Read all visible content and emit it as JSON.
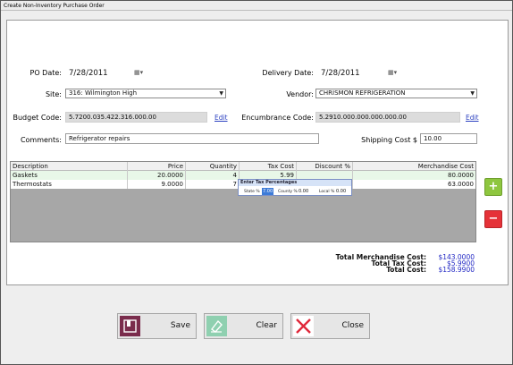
{
  "window": {
    "title": "Create Non-Inventory Purchase Order"
  },
  "form": {
    "po_date_label": "PO Date:",
    "po_date_value": "7/28/2011",
    "delivery_date_label": "Delivery Date:",
    "delivery_date_value": "7/28/2011",
    "site_label": "Site:",
    "site_value": "316: Wilmington High",
    "vendor_label": "Vendor:",
    "vendor_value": "CHRISMON REFRIGERATION",
    "budget_code_label": "Budget Code:",
    "budget_code_value": "5.7200.035.422.316.000.00",
    "budget_edit_label": "Edit",
    "encumbrance_code_label": "Encumbrance Code:",
    "encumbrance_code_value": "5.2910.000.000.000.000.00",
    "encumbrance_edit_label": "Edit",
    "comments_label": "Comments:",
    "comments_value": "Refrigerator repairs",
    "shipping_cost_label": "Shipping Cost $",
    "shipping_cost_value": "10.00"
  },
  "grid": {
    "columns": [
      "Description",
      "Price",
      "Quantity",
      "Tax Cost",
      "Discount %",
      "Merchandise Cost"
    ],
    "rows": [
      {
        "description": "Gaskets",
        "price": "20.0000",
        "quantity": "4",
        "tax_cost": "5.99",
        "discount": "",
        "merch_cost": "80.0000"
      },
      {
        "description": "Thermostats",
        "price": "9.0000",
        "quantity": "7",
        "tax_cost": "",
        "discount": "",
        "merch_cost": "63.0000"
      }
    ]
  },
  "tax_popup": {
    "title": "Enter Tax Percentages",
    "state_label": "State %",
    "state_value": "7.00",
    "county_label": "County %",
    "county_value": "0.00",
    "local_label": "Local %",
    "local_value": "0.00"
  },
  "totals": {
    "merch_label": "Total Merchandise Cost:",
    "merch_value": "$143.0000",
    "tax_label": "Total Tax Cost:",
    "tax_value": "$5.9900",
    "total_label": "Total Cost:",
    "total_value": "$158.9900"
  },
  "buttons": {
    "save_label": "Save",
    "clear_label": "Clear",
    "close_label": "Close",
    "add_label": "+",
    "remove_label": "−"
  },
  "colors": {
    "add": "#8ec63f",
    "remove": "#e53238",
    "save_icon": "#7a2c4c",
    "clear_icon": "#8fd0b0",
    "close_icon": "#e0283a",
    "totals_value": "#2228c4"
  }
}
